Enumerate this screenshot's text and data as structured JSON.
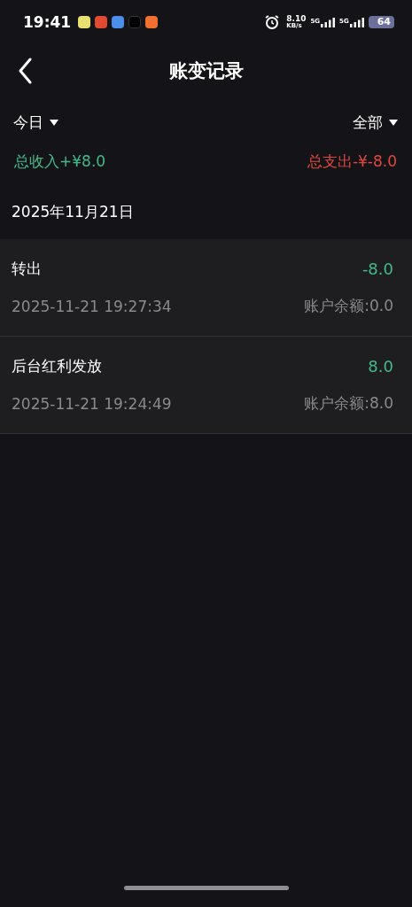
{
  "status_bar": {
    "time": "19:41",
    "speed_value": "8.10",
    "speed_unit": "KB/s",
    "networks": [
      "5G",
      "5G"
    ],
    "battery": "64"
  },
  "header": {
    "title": "账变记录"
  },
  "filters": {
    "period": "今日",
    "category": "全部"
  },
  "totals": {
    "income": "总收入+¥8.0",
    "expense": "总支出-¥-8.0"
  },
  "date": "2025年11月21日",
  "records": [
    {
      "title": "转出",
      "amount": "-8.0",
      "time": "2025-11-21 19:27:34",
      "balance": "账户余额:0.0"
    },
    {
      "title": "后台红利发放",
      "amount": "8.0",
      "time": "2025-11-21 19:24:49",
      "balance": "账户余额:8.0"
    }
  ]
}
